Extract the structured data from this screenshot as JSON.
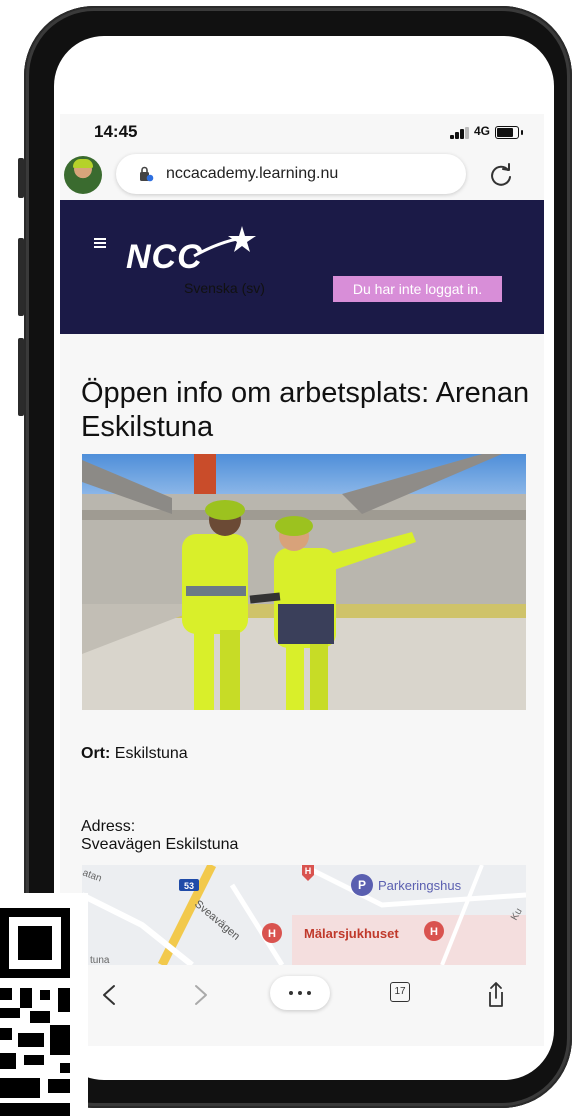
{
  "status_bar": {
    "time": "14:45",
    "network": "4G"
  },
  "browser": {
    "url": "nccacademy.learning.nu"
  },
  "header": {
    "brand": "NCC",
    "language": "Svenska (sv)",
    "login_status": "Du har inte loggat in."
  },
  "content": {
    "title": "Öppen info om arbetsplats: Arenan Eskilstuna",
    "ort_label": "Ort:",
    "ort_value": "Eskilstuna",
    "adress_label": "Adress:",
    "adress_value": "Sveavägen Eskilstuna"
  },
  "map": {
    "labels": {
      "route": "53",
      "parking": "Parkeringshus",
      "hospital": "Mälarsjukhuset",
      "road": "Sveavägen",
      "fragment_left": "atan",
      "fragment_bottom": "tuna",
      "fragment_right": "Ku"
    }
  },
  "toolbar": {
    "tab_count": "17"
  },
  "colors": {
    "header_bg": "#1b1a47",
    "login_badge": "#d88ed8",
    "hi_vis_yellow": "#d9ef2a"
  }
}
